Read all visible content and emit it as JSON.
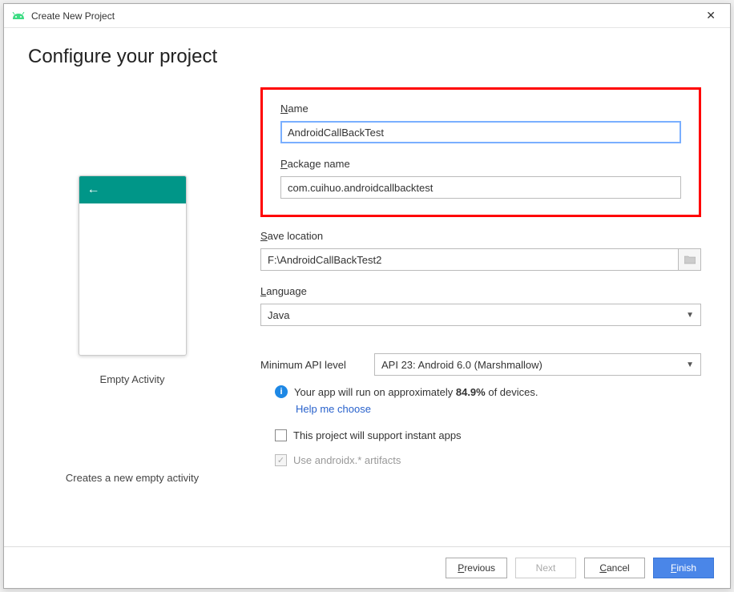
{
  "window": {
    "title": "Create New Project"
  },
  "page": {
    "heading": "Configure your project"
  },
  "template": {
    "name": "Empty Activity",
    "description": "Creates a new empty activity"
  },
  "fields": {
    "name": {
      "label": "Name",
      "mnemonic": "N",
      "rest": "ame",
      "value": "AndroidCallBackTest"
    },
    "package": {
      "label": "Package name",
      "mnemonic": "P",
      "rest": "ackage name",
      "value": "com.cuihuo.androidcallbacktest"
    },
    "save": {
      "label": "Save location",
      "mnemonic": "S",
      "rest": "ave location",
      "value": "F:\\AndroidCallBackTest2"
    },
    "language": {
      "label": "Language",
      "mnemonic": "L",
      "rest": "anguage",
      "value": "Java"
    },
    "api": {
      "label": "Minimum API level",
      "value": "API 23: Android 6.0 (Marshmallow)"
    }
  },
  "info": {
    "text_before": "Your app will run on approximately ",
    "percent": "84.9%",
    "text_after": " of devices.",
    "help_link": "Help me choose"
  },
  "checkboxes": {
    "instant": {
      "label": "This project will support instant apps",
      "checked": false,
      "enabled": true
    },
    "androidx": {
      "label": "Use androidx.* artifacts",
      "checked": true,
      "enabled": false
    }
  },
  "buttons": {
    "previous": {
      "label": "Previous",
      "mnemonic": "P",
      "rest": "revious"
    },
    "next": {
      "label": "Next",
      "mnemonic": "N",
      "rest": "ext"
    },
    "cancel": {
      "label": "Cancel",
      "mnemonic": "C",
      "rest": "ancel"
    },
    "finish": {
      "label": "Finish",
      "mnemonic": "F",
      "rest": "inish"
    }
  }
}
